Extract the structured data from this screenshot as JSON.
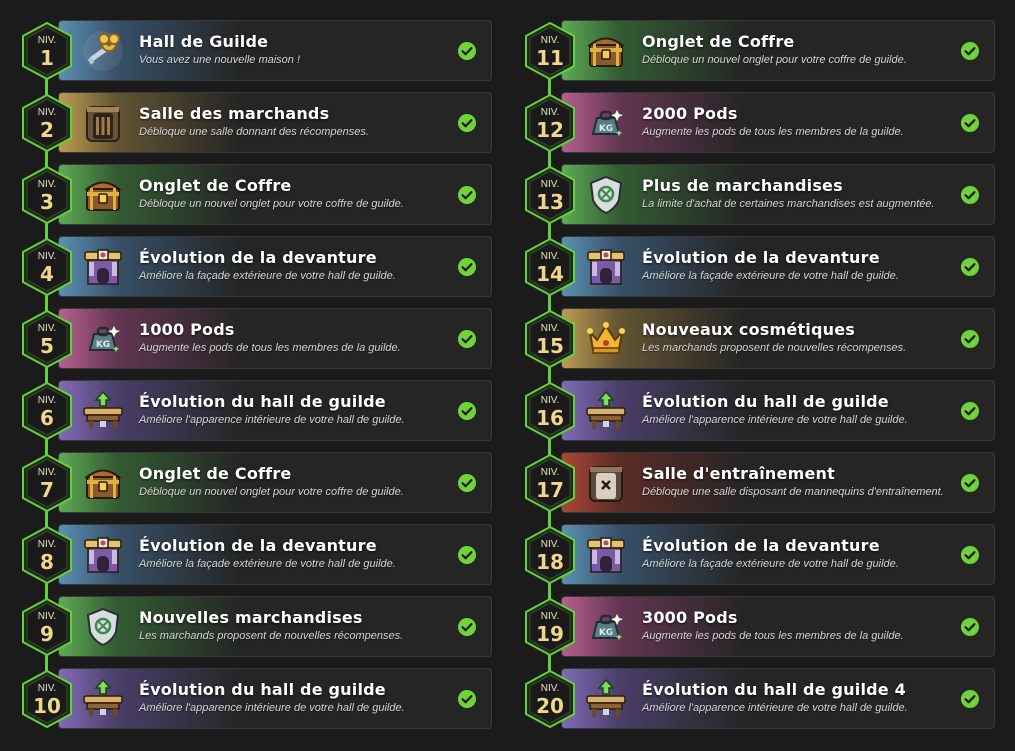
{
  "badge_prefix": "NIV.",
  "colors": {
    "background": "#1b1b1b",
    "connector": "#63d13b",
    "check": "#6fd339",
    "badge_text": "#f0d78a"
  },
  "left_column": [
    {
      "level": "1",
      "title": "Hall de Guilde",
      "desc": "Vous avez une nouvelle maison !",
      "icon": "guild-key-icon",
      "theme": "blue",
      "completed": true
    },
    {
      "level": "2",
      "title": "Salle des marchands",
      "desc": "Débloque une salle donnant des récompenses.",
      "icon": "merchant-room-door-icon",
      "theme": "gold",
      "completed": true
    },
    {
      "level": "3",
      "title": "Onglet de Coffre",
      "desc": "Débloque un nouvel onglet pour votre coffre de guilde.",
      "icon": "chest-icon",
      "theme": "green",
      "completed": true
    },
    {
      "level": "4",
      "title": "Évolution de la devanture",
      "desc": "Améliore la façade extérieure de votre hall de guilde.",
      "icon": "storefront-icon",
      "theme": "blue",
      "completed": true
    },
    {
      "level": "5",
      "title": "1000 Pods",
      "desc": "Augmente les pods de tous les membres de la guilde.",
      "icon": "weight-bag-icon",
      "theme": "pink",
      "completed": true
    },
    {
      "level": "6",
      "title": "Évolution du hall de guilde",
      "desc": "Améliore l'apparence intérieure de votre hall de guilde.",
      "icon": "guild-table-upgrade-icon",
      "theme": "purple",
      "completed": true
    },
    {
      "level": "7",
      "title": "Onglet de Coffre",
      "desc": "Débloque un nouvel onglet pour votre coffre de guilde.",
      "icon": "chest-icon",
      "theme": "green",
      "completed": true
    },
    {
      "level": "8",
      "title": "Évolution de la devanture",
      "desc": "Améliore la façade extérieure de votre hall de guilde.",
      "icon": "storefront-icon",
      "theme": "blue",
      "completed": true
    },
    {
      "level": "9",
      "title": "Nouvelles marchandises",
      "desc": "Les marchands proposent de nouvelles récompenses.",
      "icon": "merchandise-shield-icon",
      "theme": "green",
      "completed": true
    },
    {
      "level": "10",
      "title": "Évolution du hall de guilde",
      "desc": "Améliore l'apparence intérieure de votre hall de guilde.",
      "icon": "guild-table-upgrade-icon",
      "theme": "purple",
      "completed": true
    }
  ],
  "right_column": [
    {
      "level": "11",
      "title": "Onglet de Coffre",
      "desc": "Débloque un nouvel onglet pour votre coffre de guilde.",
      "icon": "chest-icon",
      "theme": "green",
      "completed": true
    },
    {
      "level": "12",
      "title": "2000 Pods",
      "desc": "Augmente les pods de tous les membres de la guilde.",
      "icon": "weight-bag-icon",
      "theme": "pink",
      "completed": true
    },
    {
      "level": "13",
      "title": "Plus de marchandises",
      "desc": "La limite d'achat de certaines marchandises est augmentée.",
      "icon": "merchandise-shield-icon",
      "theme": "green",
      "completed": true
    },
    {
      "level": "14",
      "title": "Évolution de la devanture",
      "desc": "Améliore la façade extérieure de votre hall de guilde.",
      "icon": "storefront-icon",
      "theme": "blue",
      "completed": true
    },
    {
      "level": "15",
      "title": "Nouveaux cosmétiques",
      "desc": "Les marchands proposent de nouvelles récompenses.",
      "icon": "crown-icon",
      "theme": "gold",
      "completed": true
    },
    {
      "level": "16",
      "title": "Évolution du hall de guilde",
      "desc": "Améliore l'apparence intérieure de votre hall de guilde.",
      "icon": "guild-table-upgrade-icon",
      "theme": "purple",
      "completed": true
    },
    {
      "level": "17",
      "title": "Salle d'entraînement",
      "desc": "Débloque une salle disposant de mannequins d'entraînement.",
      "icon": "training-room-door-icon",
      "theme": "red",
      "completed": true
    },
    {
      "level": "18",
      "title": "Évolution de la devanture",
      "desc": "Améliore la façade extérieure de votre hall de guilde.",
      "icon": "storefront-icon",
      "theme": "blue",
      "completed": true
    },
    {
      "level": "19",
      "title": "3000 Pods",
      "desc": "Augmente les pods de tous les membres de la guilde.",
      "icon": "weight-bag-icon",
      "theme": "pink",
      "completed": true
    },
    {
      "level": "20",
      "title": "Évolution du hall de guilde 4",
      "desc": "Améliore l'apparence intérieure de votre hall de guilde.",
      "icon": "guild-table-upgrade-icon",
      "theme": "purple",
      "completed": true
    }
  ]
}
